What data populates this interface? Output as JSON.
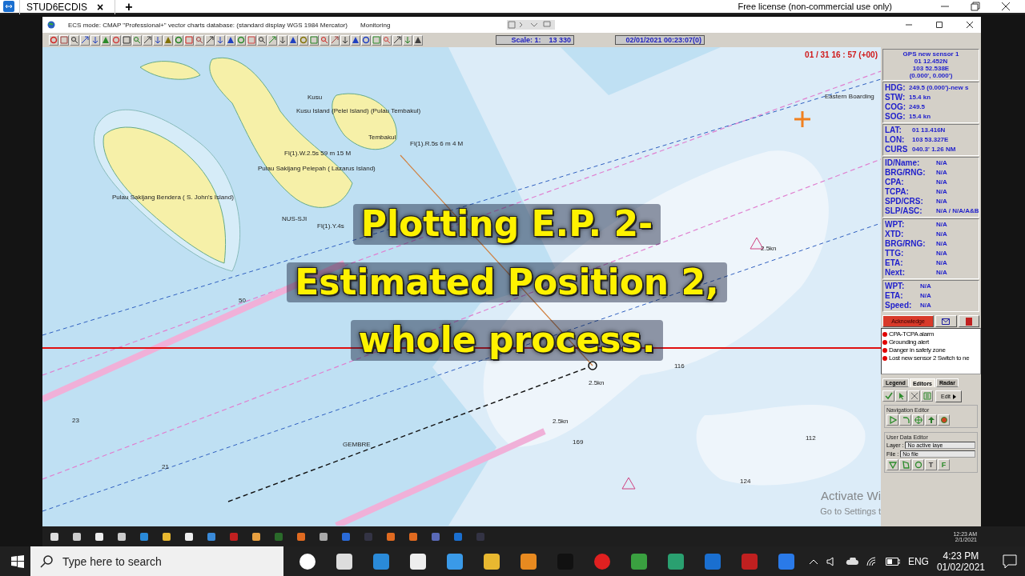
{
  "remote_tab": {
    "title": "STUD6ECDIS",
    "close": "×",
    "new_tab": "+",
    "license": "Free license (non-commercial use only)"
  },
  "window": {
    "title": "ECS mode: CMAP \"Professional+\" vector charts database: (standard display  WGS 1984 Mercator)",
    "mode": "Monitoring"
  },
  "toolbar": {
    "scale_label": "Scale: 1:",
    "scale_value": "13 330",
    "datetime": "02/01/2021 00:23:07(0)"
  },
  "map": {
    "clock": "01 / 31  16 : 57 (+00)",
    "labels": [
      "Pulau Sakijang Bendera ( S. John's Island)",
      "Pulau Sakijang Pelepah ( Lazarus Island)",
      "Kusu Island (Pelei Island) (Pulau Tembakul)",
      "Tembakul",
      "Kusu",
      "Fl(1).R.5s 6 m 4 M",
      "Fl(1).W.2.5s 59 m 15 M",
      "Fl(1).Y.4s",
      "NUS-SJI",
      "Eastern Boarding",
      "GEMBRE",
      "116",
      "112",
      "124",
      "169",
      "2.5kn",
      "2.5kn",
      "2.5kn",
      "50",
      "21",
      "23"
    ],
    "caption": [
      "Plotting E.P. 2-",
      "Estimated Position 2,",
      "whole process."
    ],
    "activation": [
      "Activate Wi",
      "Go to Settings t"
    ]
  },
  "panel": {
    "sensor": {
      "title": "GPS new sensor 1",
      "lines": [
        "01 12.452N",
        "103 52.538E",
        "(0.000', 0.000')"
      ]
    },
    "motion": [
      {
        "label": "HDG:",
        "value": "249.5 (0.000')-new s"
      },
      {
        "label": "STW:",
        "value": "15.4 kn"
      },
      {
        "label": "COG:",
        "value": "249.5"
      },
      {
        "label": "SOG:",
        "value": "15.4 kn"
      }
    ],
    "cursor": [
      {
        "label": "LAT:",
        "value": "01 13.416N"
      },
      {
        "label": "LON:",
        "value": "103 53.327E"
      },
      {
        "label": "CURS",
        "value": "040.3'   1.26 NM"
      }
    ],
    "target": [
      {
        "label": "ID/Name:",
        "value": "N/A"
      },
      {
        "label": "BRG/RNG:",
        "value": "N/A"
      },
      {
        "label": "CPA:",
        "value": "N/A"
      },
      {
        "label": "TCPA:",
        "value": "N/A"
      },
      {
        "label": "SPD/CRS:",
        "value": "N/A"
      },
      {
        "label": "SLP/ASC:",
        "value": "N/A / N/A/A&B"
      }
    ],
    "route": [
      {
        "label": "WPT:",
        "value": "N/A"
      },
      {
        "label": "XTD:",
        "value": "N/A"
      },
      {
        "label": "BRG/RNG:",
        "value": "N/A"
      },
      {
        "label": "TTG:",
        "value": "N/A"
      },
      {
        "label": "ETA:",
        "value": "N/A"
      },
      {
        "label": "Next:",
        "value": "N/A"
      }
    ],
    "next": [
      {
        "label": "WPT:",
        "value": "N/A"
      },
      {
        "label": "ETA:",
        "value": "N/A"
      },
      {
        "label": "Speed:",
        "value": "N/A"
      }
    ],
    "acknowledge": "Acknowledge",
    "alarms": [
      {
        "text": "CPA-TCPA alarm",
        "color": "#e00000"
      },
      {
        "text": "Grounding alert",
        "color": "#e00000"
      },
      {
        "text": "Danger in safety zone",
        "color": "#e00000"
      },
      {
        "text": "Lost new sensor 2 Switch to ne",
        "color": "#e00000"
      }
    ],
    "tabs": [
      {
        "label": "Legend",
        "selected": false
      },
      {
        "label": "Editors",
        "selected": true
      },
      {
        "label": "Radar",
        "selected": false
      }
    ],
    "edit": "Edit",
    "nav_editor": "Navigation Editor",
    "user_editor": "User Data Editor",
    "layer": {
      "label": "Layer :",
      "value": "No active laye"
    },
    "file": {
      "label": "File :",
      "value": "No file"
    },
    "text_tool": "T",
    "font_tool": "F"
  },
  "inner_taskbar": {
    "time": "12:23 AM",
    "date": "2/1/2021"
  },
  "taskbar": {
    "search_placeholder": "Type here to search",
    "language": "ENG",
    "time": "4:23 PM",
    "date": "01/02/2021"
  }
}
